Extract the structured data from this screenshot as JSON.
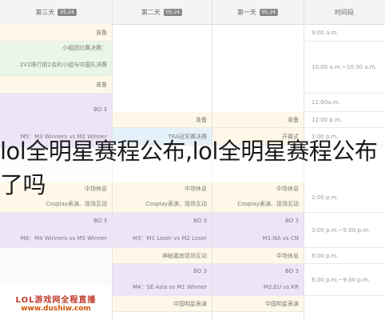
{
  "header": {
    "days": [
      "第三天",
      "第二天",
      "第一天"
    ],
    "day_badge": "05.24",
    "time_col": "时间段"
  },
  "times": [
    "9:00 a.m.",
    "10:00 a.m.~10:30 a.m.",
    "11:00a.m.",
    "12:00 p.m.",
    "1:00 p.m.",
    "2:00 p.m.",
    "3:00 p.m.~5:00 p.m.",
    "6:00 p.m.",
    "6:30 p.m.~9:00 p.m."
  ],
  "cells": {
    "d3_ready": "准备",
    "d3_group_draw": "小组团比赛决赛：",
    "d3_group_detail": "2V2排行前2名的小组与中国队决赛",
    "d3_ready2": "准备",
    "bo3": "BO 3",
    "d3_m5": "M5：M3 Winners vs M2 Winner",
    "half_break": "中场休息",
    "cosplay": "Cosplay表演、现场互动",
    "d3_m6": "M6：M4 Winners vs M5 Winner",
    "d2_ready": "准备",
    "d2_t": "TRA冠军赛决赛",
    "d2_m3": "M3：M1 Loser vs M2 Loser",
    "d2_fansign": "神秘嘉宾现场互动",
    "d2_m4": "M4：SE Asia vs M1 Winner",
    "d2_china_show": "中国明星表演",
    "d1_ready": "准备",
    "d1_open": "开幕式",
    "d1_m1": "M1:NA vs CN",
    "d1_m2": "M2:EU vs KR",
    "d1_china_show": "中国明星表演"
  },
  "overlay_text": "lol全明星赛程公布,lol全明星赛程公布了吗",
  "logo": {
    "line1": "LOL游戏网全程直播",
    "line2": "www.dushiw.com"
  }
}
